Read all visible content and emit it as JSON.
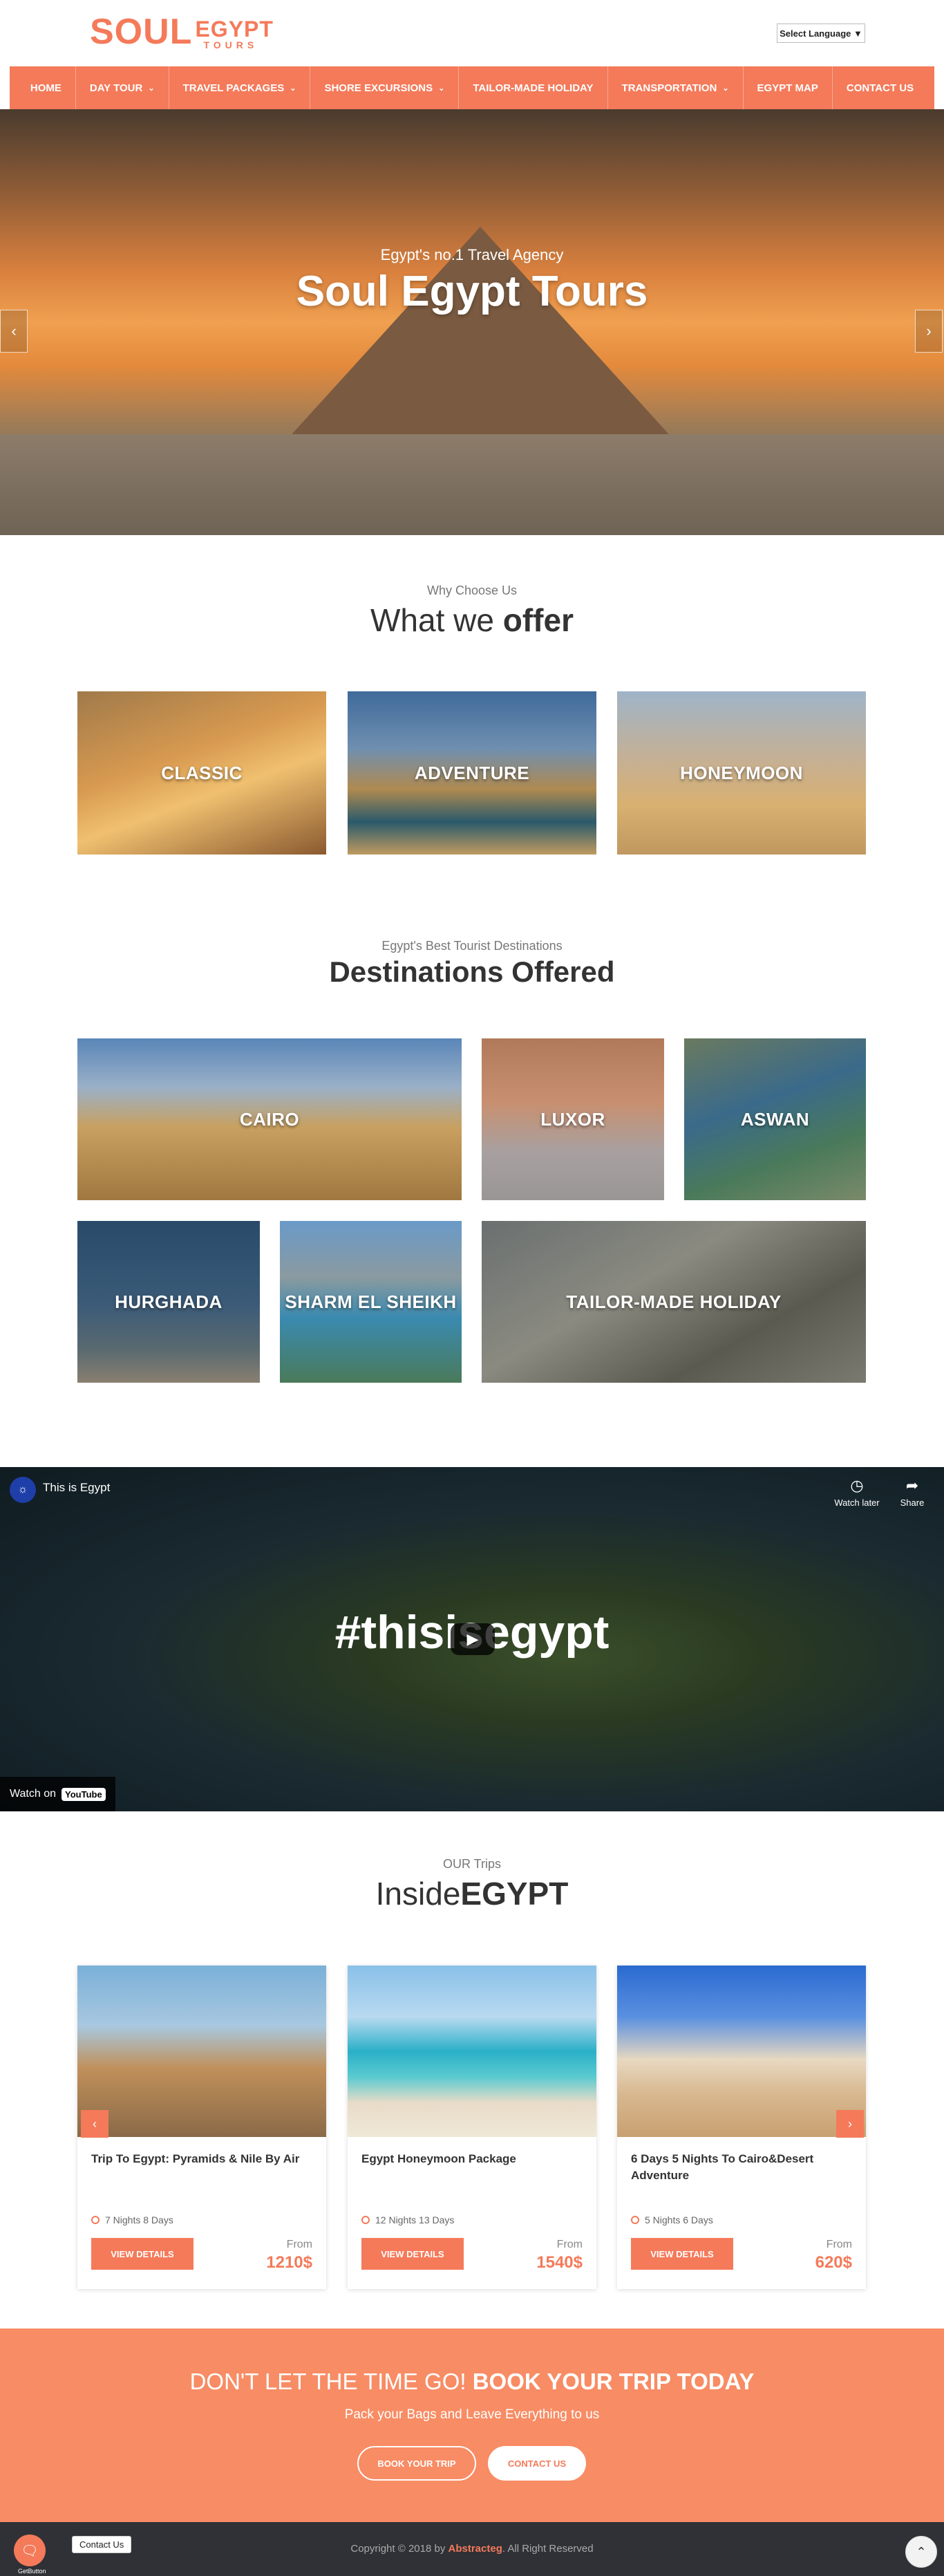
{
  "header": {
    "logo": {
      "soul": "SOUL",
      "egypt": "EGYPT",
      "tours": "TOURS"
    },
    "language_select": "Select Language ▼"
  },
  "nav": [
    {
      "label": "HOME",
      "dropdown": false
    },
    {
      "label": "DAY TOUR",
      "dropdown": true
    },
    {
      "label": "TRAVEL PACKAGES",
      "dropdown": true
    },
    {
      "label": "SHORE EXCURSIONS",
      "dropdown": true
    },
    {
      "label": "TAILOR-MADE HOLIDAY",
      "dropdown": false
    },
    {
      "label": "TRANSPORTATION",
      "dropdown": true
    },
    {
      "label": "EGYPT MAP",
      "dropdown": false
    },
    {
      "label": "CONTACT US",
      "dropdown": false
    }
  ],
  "hero": {
    "subtitle": "Egypt's no.1 Travel Agency",
    "title": "Soul Egypt Tours",
    "prev_icon": "chevron-left-icon",
    "next_icon": "chevron-right-icon"
  },
  "offer": {
    "small": "Why Choose Us",
    "big_light": "What we ",
    "big_bold": "offer",
    "tiles": [
      "CLASSIC",
      "ADVENTURE",
      "HONEYMOON"
    ]
  },
  "destinations": {
    "small": "Egypt's Best Tourist Destinations",
    "big": "Destinations Offered",
    "tiles": [
      "CAIRO",
      "LUXOR",
      "ASWAN",
      "HURGHADA",
      "SHARM EL SHEIKH",
      "TAILOR-MADE HOLIDAY"
    ]
  },
  "video": {
    "title": "This is Egypt",
    "watch_later": "Watch later",
    "share": "Share",
    "overlay_text": "#thisisegypt",
    "watch_on": "Watch on",
    "youtube": "YouTube"
  },
  "trips": {
    "small": "OUR Trips",
    "big_light": "Inside",
    "big_bold": "EGYPT",
    "cards": [
      {
        "title": "Trip To Egypt: Pyramids & Nile By Air",
        "nights": "7 Nights 8 Days",
        "button": "VIEW DETAILS",
        "from": "From",
        "price": "1210$"
      },
      {
        "title": "Egypt Honeymoon Package",
        "nights": "12 Nights 13 Days",
        "button": "VIEW DETAILS",
        "from": "From",
        "price": "1540$"
      },
      {
        "title": "6 Days 5 Nights To Cairo&Desert Adventure",
        "nights": "5 Nights 6 Days",
        "button": "VIEW DETAILS",
        "from": "From",
        "price": "620$"
      }
    ]
  },
  "cta": {
    "title_light": "DON'T LET THE TIME GO! ",
    "title_bold": "BOOK YOUR TRIP TODAY",
    "subtitle": "Pack your Bags and Leave Everything to us",
    "book_button": "BOOK YOUR TRIP",
    "contact_button": "CONTACT US"
  },
  "footer": {
    "copyright_pre": "Copyright © 2018 by ",
    "brand": "Abstracteg",
    "copyright_post": ". All Right Reserved",
    "contact_tip": "Contact Us",
    "getbutton_label": "GetButton"
  },
  "colors": {
    "accent": "#f47a5a",
    "cta_bg": "#f88c64",
    "footer_bg": "#2f3136"
  }
}
